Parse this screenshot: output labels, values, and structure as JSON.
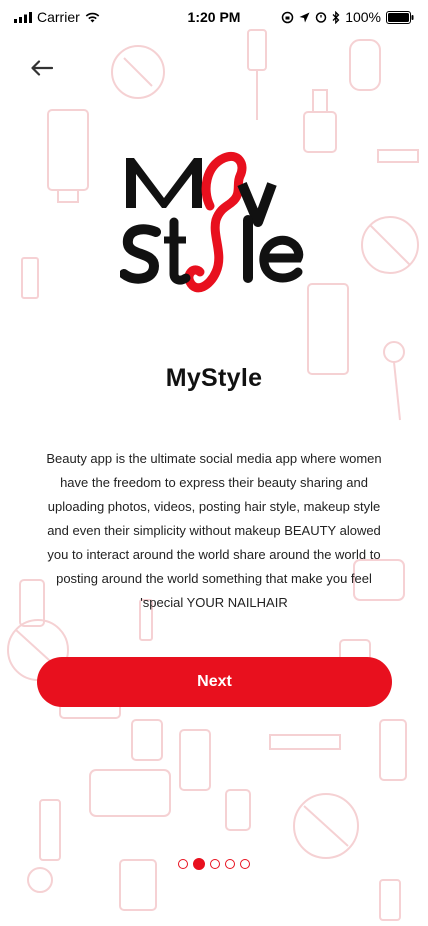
{
  "status_bar": {
    "carrier": "Carrier",
    "time": "1:20 PM",
    "battery": "100%"
  },
  "logo_text": "MyStyle",
  "title": "MyStyle",
  "description": "Beauty app is the ultimate social media app where women have the freedom to express their beauty sharing and uploading photos, videos, posting hair style, makeup style and even their simplicity without makeup BEAUTY alowed you to interact around the world share around the world to posting around the world something that make you feel 'special YOUR NAILHAIR",
  "next_label": "Next",
  "pagination": {
    "total": 5,
    "current_index": 1
  },
  "colors": {
    "accent": "#e8101e",
    "pattern": "#f4c9cc",
    "text": "#111111"
  }
}
